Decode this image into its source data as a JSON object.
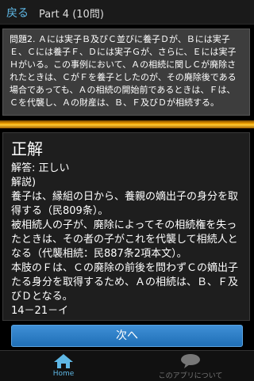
{
  "header": {
    "back_label": "戻る",
    "title": "Part 4 (10問)"
  },
  "question": {
    "text": "問題2. Ａには実子Ｂ及びＣ並びに養子Ｄが、Ｂには実子Ｅ、Ｃには養子Ｆ、Ｄには実子Ｇが、さらに、Ｅには実子Ｈがいる。この事例において、Ａの相続に関しＣが廃除されたときは、ＣがＦを養子としたのが、その廃除後である場合であっても、Ａの相続の開始前であるときは、Ｆは、Ｃを代襲し、Ａの財産は、Ｂ、Ｆ及びＤが相続する。"
  },
  "answer": {
    "result": "正解",
    "answer_line": "解答: 正しい",
    "explanation_label": "解説)",
    "explanation": [
      "養子は、縁組の日から、養親の嫡出子の身分を取得する（民809条）。",
      "被相続人の子が、廃除によってその相続権を失ったときは、その者の子がこれを代襲して相続人となる（代襲相続：民887条2項本文）。",
      "本肢のＦは、Ｃの廃除の前後を問わずＣの嫡出子たる身分を取得するため、Ａの相続は、Ｂ、Ｆ及びＤとなる。"
    ],
    "reference": "14－21－イ"
  },
  "next_button_label": "次へ",
  "tabbar": {
    "home_label": "Home",
    "about_label": "このアプリについて"
  },
  "colors": {
    "accent": "#5fb8e6",
    "button": "#2b7fc8",
    "divider": "#f0a000"
  }
}
